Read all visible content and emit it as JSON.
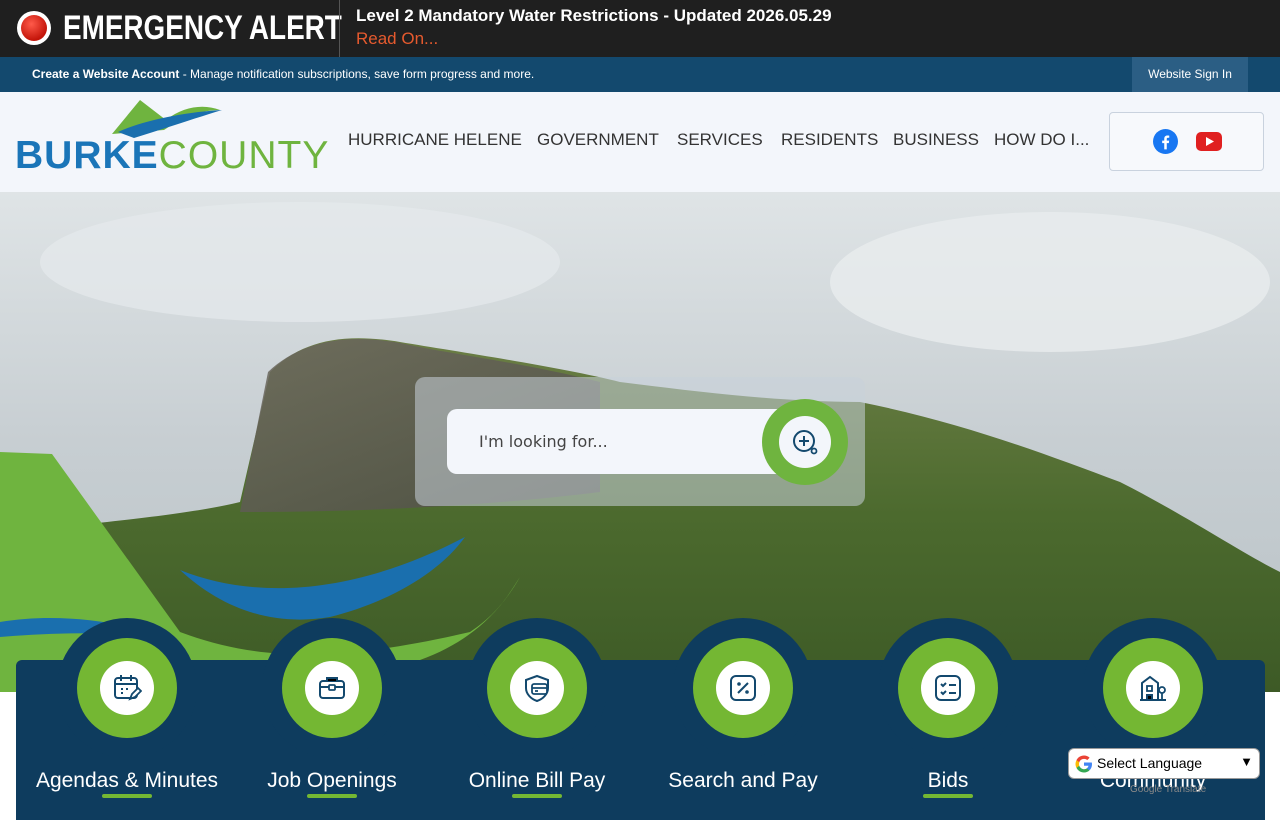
{
  "alert": {
    "title": "EMERGENCY ALERT",
    "message": "Level 2 Mandatory Water Restrictions - Updated 2026.05.29",
    "link": "Read On..."
  },
  "account_bar": {
    "bold": "Create a Website Account",
    "text": " - Manage notification subscriptions, save form progress and more.",
    "signin": "Website Sign In"
  },
  "logo": {
    "part1": "BURKE",
    "part2": "COUNTY"
  },
  "nav": [
    "HURRICANE HELENE",
    "GOVERNMENT",
    "SERVICES",
    "RESIDENTS",
    "BUSINESS",
    "HOW DO I..."
  ],
  "social": {
    "facebook": "facebook-icon",
    "youtube": "youtube-icon"
  },
  "search": {
    "placeholder": "I'm looking for..."
  },
  "quick_links": [
    {
      "label": "Agendas & Minutes",
      "icon": "calendar-edit-icon"
    },
    {
      "label": "Job Openings",
      "icon": "briefcase-icon"
    },
    {
      "label": "Online Bill Pay",
      "icon": "credit-card-icon"
    },
    {
      "label": "Search and Pay",
      "icon": "percent-icon"
    },
    {
      "label": "Bids",
      "icon": "checklist-icon"
    },
    {
      "label": "Community",
      "icon": "building-tree-icon"
    }
  ],
  "translate": {
    "label": "Select Language",
    "powered": "Google Translate"
  },
  "colors": {
    "accent_green": "#74b733",
    "navy": "#0e3c5e",
    "blue": "#1a75b8",
    "alert_red": "#e65a2e"
  }
}
